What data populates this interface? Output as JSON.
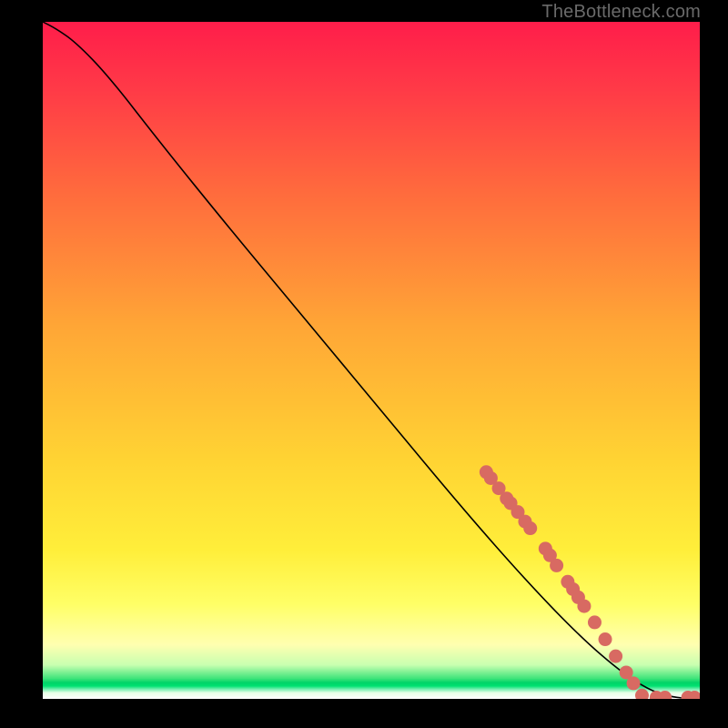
{
  "watermark": "TheBottleneck.com",
  "chart_data": {
    "type": "line",
    "title": "",
    "xlabel": "",
    "ylabel": "",
    "x": [
      0.0,
      0.02,
      0.05,
      0.1,
      0.18,
      0.28,
      0.4,
      0.52,
      0.64,
      0.74,
      0.82,
      0.88,
      0.92,
      0.95,
      0.98,
      1.0
    ],
    "y": [
      1.0,
      0.99,
      0.97,
      0.92,
      0.82,
      0.7,
      0.56,
      0.42,
      0.28,
      0.17,
      0.09,
      0.04,
      0.015,
      0.004,
      0.0005,
      0.0
    ],
    "xlim": [
      0,
      1
    ],
    "ylim": [
      0,
      1
    ],
    "markers": [
      {
        "xu": 0.675,
        "yu": 0.335
      },
      {
        "xu": 0.682,
        "yu": 0.326
      },
      {
        "xu": 0.694,
        "yu": 0.311
      },
      {
        "xu": 0.706,
        "yu": 0.296
      },
      {
        "xu": 0.712,
        "yu": 0.289
      },
      {
        "xu": 0.723,
        "yu": 0.276
      },
      {
        "xu": 0.734,
        "yu": 0.262
      },
      {
        "xu": 0.742,
        "yu": 0.252
      },
      {
        "xu": 0.765,
        "yu": 0.222
      },
      {
        "xu": 0.772,
        "yu": 0.212
      },
      {
        "xu": 0.782,
        "yu": 0.197
      },
      {
        "xu": 0.799,
        "yu": 0.173
      },
      {
        "xu": 0.807,
        "yu": 0.162
      },
      {
        "xu": 0.815,
        "yu": 0.15
      },
      {
        "xu": 0.824,
        "yu": 0.137
      },
      {
        "xu": 0.84,
        "yu": 0.113
      },
      {
        "xu": 0.856,
        "yu": 0.088
      },
      {
        "xu": 0.872,
        "yu": 0.063
      },
      {
        "xu": 0.888,
        "yu": 0.039
      },
      {
        "xu": 0.899,
        "yu": 0.023
      },
      {
        "xu": 0.912,
        "yu": 0.005
      },
      {
        "xu": 0.934,
        "yu": 0.002
      },
      {
        "xu": 0.947,
        "yu": 0.002
      },
      {
        "xu": 0.982,
        "yu": 0.002
      },
      {
        "xu": 0.992,
        "yu": 0.002
      }
    ],
    "gradient_stops": [
      {
        "pos": 0.0,
        "color": "#ff1d4a"
      },
      {
        "pos": 0.45,
        "color": "#ffa636"
      },
      {
        "pos": 0.78,
        "color": "#ffee3a"
      },
      {
        "pos": 0.97,
        "color": "#3ee47a"
      },
      {
        "pos": 1.0,
        "color": "#ffffff"
      }
    ]
  }
}
